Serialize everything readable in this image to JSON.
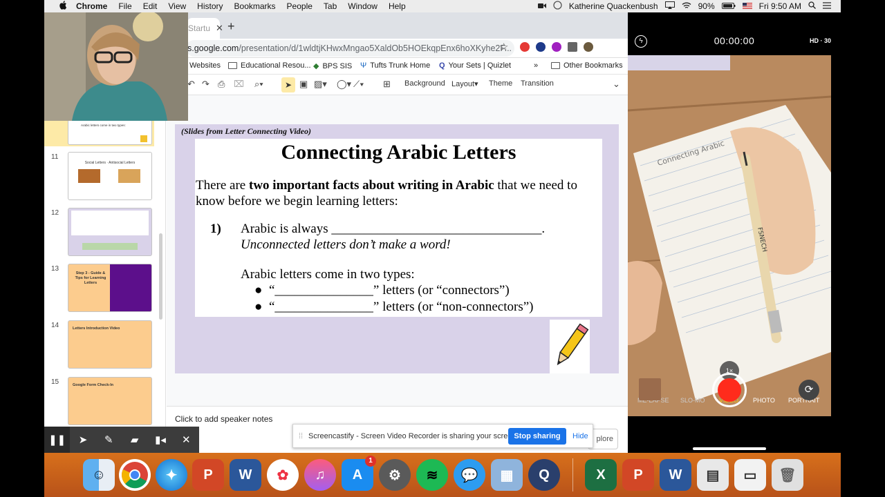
{
  "menubar": {
    "apple": "",
    "app": "Chrome",
    "items": [
      "File",
      "Edit",
      "View",
      "History",
      "Bookmarks",
      "People",
      "Tab",
      "Window",
      "Help"
    ],
    "user": "Katherine Quackenbush",
    "battery": "90%",
    "clock": "Fri 9:50 AM"
  },
  "browser": {
    "tab_label": "Startu",
    "url_host": "s.google.com",
    "url_path": "/presentation/d/1wldtjKHwxMngao5XaldOb5HOEkqpEnx6hoXKyhe2F...",
    "bookmarks": [
      "Websites",
      "Educational Resou...",
      "BPS SIS",
      "Tufts Trunk Home",
      "Your Sets | Quizlet",
      "»",
      "Other Bookmarks"
    ]
  },
  "toolbar": {
    "background": "Background",
    "layout": "Layout",
    "theme": "Theme",
    "transition": "Transition"
  },
  "filmstrip": {
    "slides": [
      {
        "num": "11",
        "title": "",
        "text": "Social Letters · Antisocial Letters"
      },
      {
        "num": "12",
        "title": "",
        "text": ""
      },
      {
        "num": "13",
        "title": "Step 3 - Guide & Tips for Learning Letters",
        "text": ""
      },
      {
        "num": "14",
        "title": "Letters Introduction Video",
        "text": ""
      },
      {
        "num": "15",
        "title": "Google Form Check-In",
        "text": ""
      }
    ],
    "partial_text": "Arabic letters come in two types:"
  },
  "slide": {
    "caption": "(Slides from Letter Connecting Video)",
    "title": "Connecting Arabic Letters",
    "intro_a": "There are ",
    "intro_bold": "two important facts about writing in Arabic",
    "intro_b": " that we need to know before we begin learning letters:",
    "num": "1)",
    "line1": "Arabic is always ________________________________.",
    "line2": "Unconnected letters don’t make a word!",
    "line3": "Arabic letters come in two types:",
    "bullet1": "“_______________” letters (or “connectors”)",
    "bullet2": "“_______________” letters (or “non-connectors”)"
  },
  "notes": {
    "placeholder": "Click to add speaker notes"
  },
  "explore": "plore",
  "banner": {
    "text": "Screencastify - Screen Video Recorder is sharing your screen.",
    "stop": "Stop sharing",
    "hide": "Hide"
  },
  "phone": {
    "timer": "00:00:00",
    "quality": "HD · 30",
    "zoom": "1×",
    "modes": [
      "ME-LAPSE",
      "SLO-MO",
      "VIDEO",
      "PHOTO",
      "PORTRAIT"
    ],
    "pencil_text": "FSNECH",
    "notebook_text": "Connecting Arabic"
  },
  "dock": {
    "badge": "1"
  },
  "colors": {
    "slide_bg": "#d9d2e9",
    "thumb13_left": "#fccc8e",
    "thumb13_right": "#5c0f8b",
    "thumb_orange": "#fccc8e",
    "stop_button": "#1a73e8",
    "record": "#ff2b1c",
    "dock": "#c4601b"
  }
}
